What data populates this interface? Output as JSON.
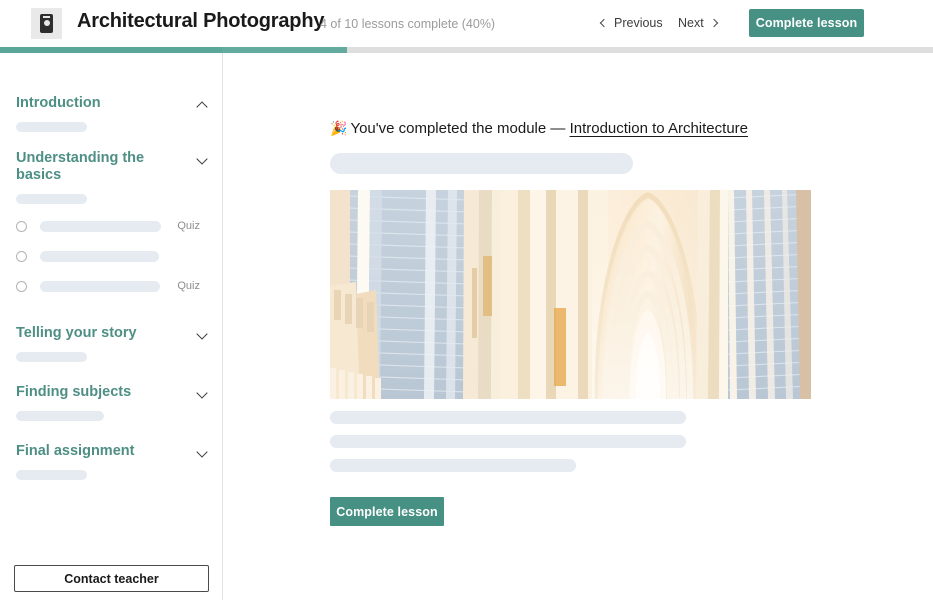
{
  "header": {
    "logo_icon": "camera-icon",
    "course_title": "Architectural Photography",
    "progress_text": "4 of 10 lessons complete (40%)",
    "previous_label": "Previous",
    "next_label": "Next",
    "complete_lesson_label": "Complete lesson",
    "accent_color": "#469184",
    "progress_percent": 37
  },
  "sidebar": {
    "sections": [
      {
        "title": "Introduction",
        "expanded": true,
        "caret_icon": "chevron-up-icon"
      },
      {
        "title": "Understanding the basics",
        "expanded": false,
        "caret_icon": "chevron-down-icon"
      },
      {
        "title": "Telling your story",
        "expanded": false,
        "caret_icon": "chevron-down-icon"
      },
      {
        "title": "Finding subjects",
        "expanded": false,
        "caret_icon": "chevron-down-icon"
      },
      {
        "title": "Final assignment",
        "expanded": false,
        "caret_icon": "chevron-down-icon"
      }
    ],
    "lessons": [
      {
        "status_icon": "radio-unchecked-icon",
        "badge": "Quiz"
      },
      {
        "status_icon": "radio-unchecked-icon",
        "badge": ""
      },
      {
        "status_icon": "radio-unchecked-icon",
        "badge": "Quiz"
      }
    ],
    "contact_teacher_label": "Contact teacher"
  },
  "main": {
    "celebration_icon": "🎉",
    "heading_prefix": "You've completed the module —",
    "module_name": "Introduction to Architecture",
    "image_alt": "cathedral-interior-photo",
    "complete_lesson_label": "Complete lesson"
  }
}
